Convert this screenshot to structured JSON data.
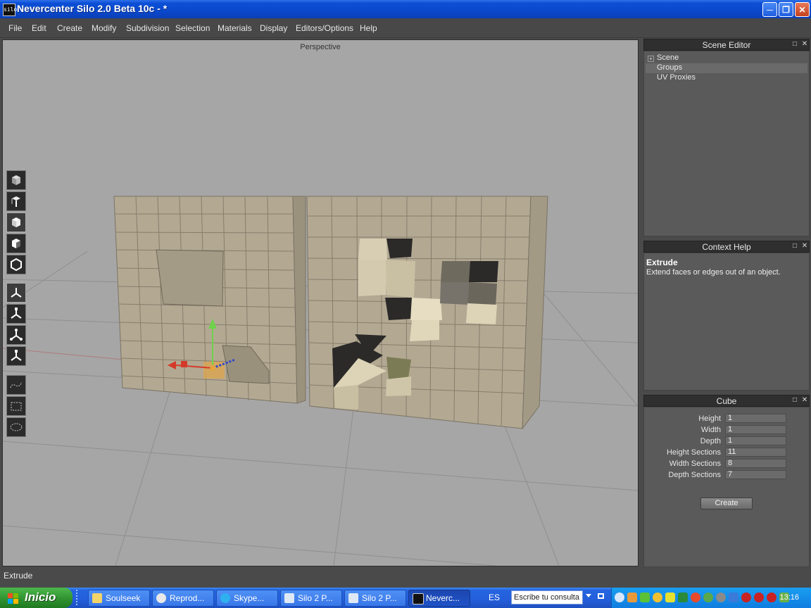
{
  "window": {
    "title": "Nevercenter Silo 2.0 Beta 10c - *",
    "logo_text": "silo"
  },
  "menu": [
    "File",
    "Edit",
    "Create",
    "Modify",
    "Subdivision",
    "Selection",
    "Materials",
    "Display",
    "Editors/Options",
    "Help"
  ],
  "viewport": {
    "label": "Perspective"
  },
  "panels": {
    "scene_editor": {
      "title": "Scene Editor",
      "items": [
        "Scene",
        "Groups",
        "UV Proxies"
      ]
    },
    "context_help": {
      "title": "Context Help",
      "heading": "Extrude",
      "text": "Extend faces or edges out of an object."
    },
    "cube": {
      "title": "Cube",
      "fields": [
        {
          "label": "Height",
          "value": "1"
        },
        {
          "label": "Width",
          "value": "1"
        },
        {
          "label": "Depth",
          "value": "1"
        },
        {
          "label": "Height Sections",
          "value": "11"
        },
        {
          "label": "Width Sections",
          "value": "8"
        },
        {
          "label": "Depth Sections",
          "value": "7"
        }
      ],
      "create_label": "Create"
    }
  },
  "status": "Extrude",
  "taskbar": {
    "start_label": "Inicio",
    "tasks": [
      "Soulseek",
      "Reprod...",
      "Skype...",
      "Silo 2 P...",
      "Silo 2 P...",
      "Neverc..."
    ],
    "language": "ES",
    "search_placeholder": "Escribe tu consulta",
    "clock": "13:16"
  },
  "colors": {
    "viewport_bg": "#a6a6a6",
    "mesh_face": "#b3a993",
    "panel_header": "#2f2f2f",
    "taskbar": "#245edb"
  }
}
